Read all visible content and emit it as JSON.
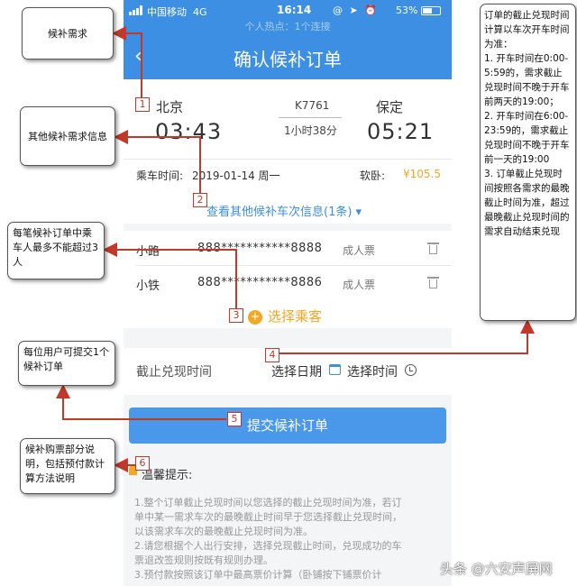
{
  "status_bar": {
    "carrier": "中国移动",
    "network": "4G",
    "time": "16:14",
    "icons": "@ ➤ ⏰",
    "battery": "53%"
  },
  "hotspot": "个人热点：1个连接",
  "nav": {
    "back": "‹",
    "title": "确认候补订单"
  },
  "train": {
    "from_station": "北京",
    "from_time": "03:43",
    "train_no": "K7761",
    "duration": "1小时38分",
    "to_station": "保定",
    "to_time": "05:21",
    "ride_label": "乘车时间:",
    "ride_date": "2019-01-14 周一",
    "seat": "软卧:",
    "price": "¥105.5",
    "more_link": "查看其他候补车次信息(1条) ▾"
  },
  "passengers": [
    {
      "name": "小路",
      "id": "888***********8888",
      "type": "成人票"
    },
    {
      "name": "小铁",
      "id": "888***********8886",
      "type": "成人票"
    }
  ],
  "add_passenger": "选择乘客",
  "deadline": {
    "label": "截止兑现时间",
    "date": "选择日期",
    "time": "选择时间"
  },
  "submit": "提交候补订单",
  "tips": {
    "title": "温馨提示:",
    "lines": [
      "1.整个订单截止兑现时间以您选择的截止兑现时间为准，若订",
      "单中某一需求车次的最晚截止时间早于您选择截止兑现时间，",
      "以该需求车次的最晚截止兑现时间为准。",
      "2.请您根据个人出行安排，选择兑现截止时间，兑现成功的车",
      "票退改签规则按既有规则办理。",
      "3.预付款按照该订单中最高票价计算（卧铺按下铺票价计"
    ]
  },
  "notes": {
    "n1": "候补需求",
    "n2": "其他候补需求信息",
    "n3": "每笔候补订单中乘车人最多不能超过3人",
    "n4": "每位用户可提交1个候补订单",
    "n5": "候补购票部分说明，包括预付款计算方法说明",
    "n6": "订单的截止兑现时间计算以车次开车时间为准：\n1. 开车时间在0:00-5:59的，需求截止兑现时间不晚于开车前两天的19:00；\n2. 开车时间在6:00-23:59的，需求截止兑现时间不晚于开车前一天的19:00\n3. 订单截止兑现时间按照各需求的最晚截止时间为准，超过最晚截止兑现时间的需求自动结束兑现"
  },
  "markers": [
    "1",
    "2",
    "3",
    "4",
    "5",
    "6"
  ],
  "watermark": "头条 @六安声屏网",
  "colors": {
    "primary_blue": "#3d8fe3",
    "accent_orange": "#f5a623",
    "annotation_red": "#c0392b"
  }
}
